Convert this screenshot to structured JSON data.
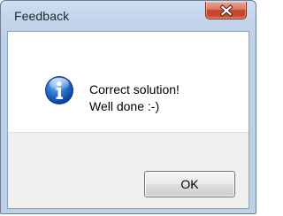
{
  "window": {
    "title": "Feedback",
    "close_icon": "close-x-icon"
  },
  "message": {
    "icon": "information-icon",
    "line1": "Correct solution!",
    "line2": "Well done :-)"
  },
  "buttons": {
    "ok_label": "OK"
  },
  "colors": {
    "close_button": "#c7462d",
    "info_icon": "#1f6fc5",
    "footer_bg": "#f0f0f0"
  }
}
